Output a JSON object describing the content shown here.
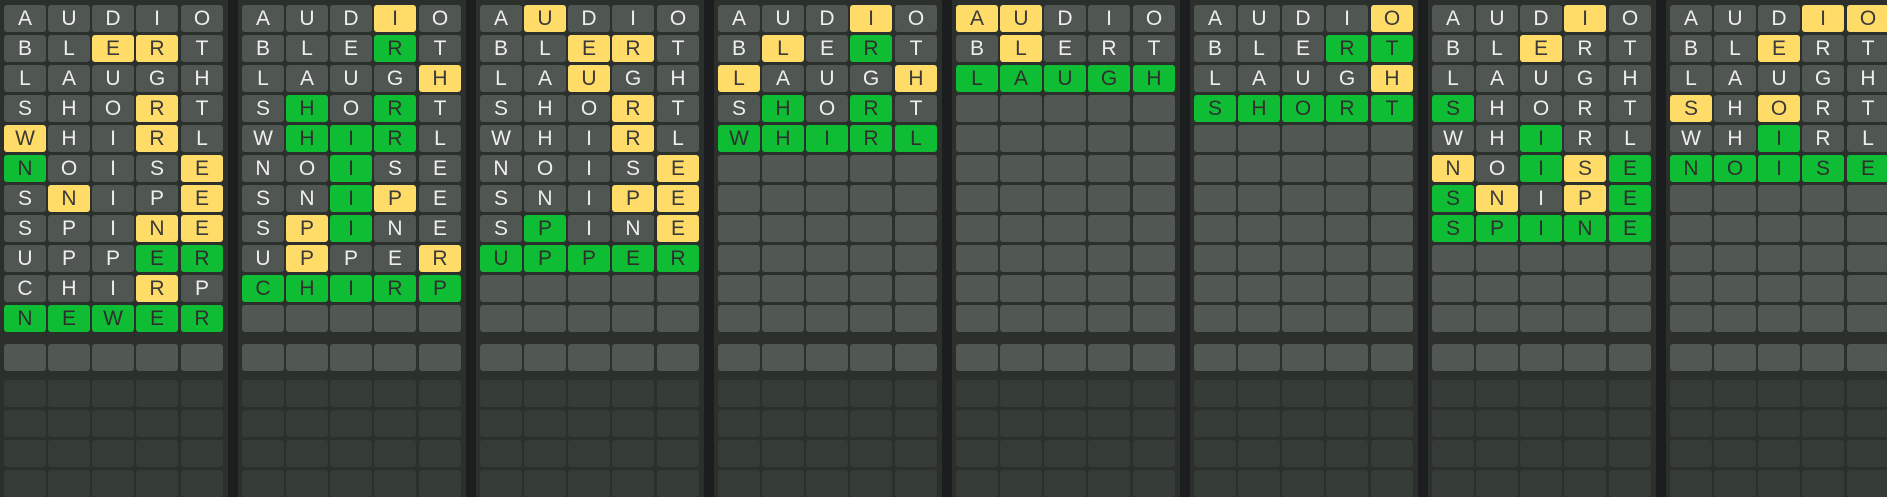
{
  "colors": {
    "page_background": "#1b1d1e",
    "board_background": "#2c302d",
    "absent": "#505652",
    "present": "#ffdb67",
    "correct": "#0fbd35",
    "empty_active": "#515752",
    "empty_future": "#353b36"
  },
  "rows_per_board": 16,
  "active_rows_per_board": 12,
  "boards": [
    {
      "guesses": [
        {
          "word": "AUDIO",
          "result": "GGGGG"
        },
        {
          "word": "BLERT",
          "result": "GGYYG"
        },
        {
          "word": "LAUGH",
          "result": "GGGGG"
        },
        {
          "word": "SHORT",
          "result": "GGGYG"
        },
        {
          "word": "WHIRL",
          "result": "YGGYG"
        },
        {
          "word": "NOISE",
          "result": "CGGGY"
        },
        {
          "word": "SNIPE",
          "result": "GYGGY"
        },
        {
          "word": "SPINE",
          "result": "GGGYY"
        },
        {
          "word": "UPPER",
          "result": "GGGCC"
        },
        {
          "word": "CHIRP",
          "result": "GGGYG"
        },
        {
          "word": "NEWER",
          "result": "CCCCC"
        }
      ]
    },
    {
      "guesses": [
        {
          "word": "AUDIO",
          "result": "GGGYG"
        },
        {
          "word": "BLERT",
          "result": "GGGCG"
        },
        {
          "word": "LAUGH",
          "result": "GGGGY"
        },
        {
          "word": "SHORT",
          "result": "GCGCG"
        },
        {
          "word": "WHIRL",
          "result": "GCCCG"
        },
        {
          "word": "NOISE",
          "result": "GGCGG"
        },
        {
          "word": "SNIPE",
          "result": "GGCYG"
        },
        {
          "word": "SPINE",
          "result": "GYCGG"
        },
        {
          "word": "UPPER",
          "result": "GYGGY"
        },
        {
          "word": "CHIRP",
          "result": "CCCCC"
        }
      ]
    },
    {
      "guesses": [
        {
          "word": "AUDIO",
          "result": "GYGGG"
        },
        {
          "word": "BLERT",
          "result": "GGYYG"
        },
        {
          "word": "LAUGH",
          "result": "GGYGG"
        },
        {
          "word": "SHORT",
          "result": "GGGYG"
        },
        {
          "word": "WHIRL",
          "result": "GGGYG"
        },
        {
          "word": "NOISE",
          "result": "GGGGY"
        },
        {
          "word": "SNIPE",
          "result": "GGGYY"
        },
        {
          "word": "SPINE",
          "result": "GCGGY"
        },
        {
          "word": "UPPER",
          "result": "CCCCC"
        }
      ]
    },
    {
      "guesses": [
        {
          "word": "AUDIO",
          "result": "GGGYG"
        },
        {
          "word": "BLERT",
          "result": "GYGCG"
        },
        {
          "word": "LAUGH",
          "result": "YGGGY"
        },
        {
          "word": "SHORT",
          "result": "GCGCG"
        },
        {
          "word": "WHIRL",
          "result": "CCCCC"
        }
      ]
    },
    {
      "guesses": [
        {
          "word": "AUDIO",
          "result": "YYGGG"
        },
        {
          "word": "BLERT",
          "result": "GYGGG"
        },
        {
          "word": "LAUGH",
          "result": "CCCCC"
        }
      ]
    },
    {
      "guesses": [
        {
          "word": "AUDIO",
          "result": "GGGGY"
        },
        {
          "word": "BLERT",
          "result": "GGGCC"
        },
        {
          "word": "LAUGH",
          "result": "GGGGY"
        },
        {
          "word": "SHORT",
          "result": "CCCCC"
        }
      ]
    },
    {
      "guesses": [
        {
          "word": "AUDIO",
          "result": "GGGYG"
        },
        {
          "word": "BLERT",
          "result": "GGYGG"
        },
        {
          "word": "LAUGH",
          "result": "GGGGG"
        },
        {
          "word": "SHORT",
          "result": "CGGGG"
        },
        {
          "word": "WHIRL",
          "result": "GGCGG"
        },
        {
          "word": "NOISE",
          "result": "YGCYC"
        },
        {
          "word": "SNIPE",
          "result": "CYGYC"
        },
        {
          "word": "SPINE",
          "result": "CCCCC"
        }
      ]
    },
    {
      "guesses": [
        {
          "word": "AUDIO",
          "result": "GGGYY"
        },
        {
          "word": "BLERT",
          "result": "GGYGG"
        },
        {
          "word": "LAUGH",
          "result": "GGGGG"
        },
        {
          "word": "SHORT",
          "result": "YGYGG"
        },
        {
          "word": "WHIRL",
          "result": "GGCGG"
        },
        {
          "word": "NOISE",
          "result": "CCCCC"
        }
      ]
    }
  ]
}
